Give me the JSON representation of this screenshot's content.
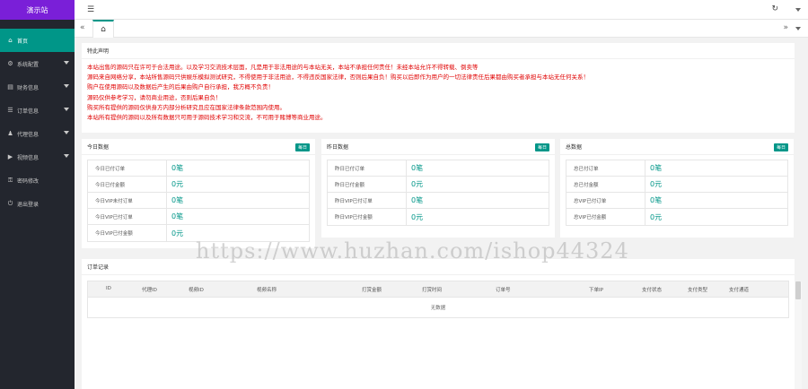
{
  "sidebar": {
    "logo": "演示站",
    "items": [
      {
        "icon": "home-icon",
        "glyph": "⌂",
        "label": "首页",
        "active": true,
        "has_arrow": false
      },
      {
        "icon": "settings-icon",
        "glyph": "⚙",
        "label": "系统配置",
        "active": false,
        "has_arrow": true
      },
      {
        "icon": "finance-icon",
        "glyph": "▤",
        "label": "财务信息",
        "active": false,
        "has_arrow": true
      },
      {
        "icon": "order-icon",
        "glyph": "☰",
        "label": "订单信息",
        "active": false,
        "has_arrow": true
      },
      {
        "icon": "agent-icon",
        "glyph": "♟",
        "label": "代理信息",
        "active": false,
        "has_arrow": true
      },
      {
        "icon": "video-icon",
        "glyph": "▶",
        "label": "视频信息",
        "active": false,
        "has_arrow": true
      },
      {
        "icon": "password-icon",
        "glyph": "⚿",
        "label": "密码修改",
        "active": false,
        "has_arrow": false
      },
      {
        "icon": "logout-icon",
        "glyph": "⏻",
        "label": "退出登录",
        "active": false,
        "has_arrow": false
      }
    ]
  },
  "header": {
    "menu_icon": "☰",
    "refresh_icon": "↻"
  },
  "tabs": {
    "prev_icon": "«",
    "home_icon": "⌂",
    "next_icon": "»"
  },
  "notice": {
    "title": "特此声明",
    "lines": [
      "本站出售的源码只在许可于合法用途。以及学习交流技术层面，凡是用于非法用途的与本站无关，本站不承担任何责任！未经本站允许不得转载、倒卖等",
      "源码来自网络分享，本站所售源码只供娱乐模拟测试研究，不得使用于非法用途，不得违反国家法律，否则后果自负！购买以后即作为用户的一切法律责任后果都由购买者承担与本站无任何关系！",
      "购户在使用源码以及数据后产生的后果由购户自行承担，我方概不负责！",
      "源码仅供参考学习，请勿商业用途，否则后果自负！",
      "购买所有提供的源码仅供身方内部分析研究且应在国家法律条款范围内使用。",
      "本站所有提供的源码以及所有数据只可用于源码技术学习和交流，不可用于赌博等商业用途。"
    ]
  },
  "today": {
    "title": "今日数据",
    "badge": "每日",
    "rows": [
      {
        "label": "今日已付订单",
        "value": "0笔"
      },
      {
        "label": "今日已付金额",
        "value": "0元"
      },
      {
        "label": "今日VIP未付订单",
        "value": "0笔"
      },
      {
        "label": "今日VIP已付订单",
        "value": "0笔"
      },
      {
        "label": "今日VIP已付金额",
        "value": "0元"
      }
    ]
  },
  "yesterday": {
    "title": "昨日数据",
    "badge": "每日",
    "rows": [
      {
        "label": "昨日已付订单",
        "value": "0笔"
      },
      {
        "label": "昨日已付金额",
        "value": "0元"
      },
      {
        "label": "昨日VIP已付订单",
        "value": "0笔"
      },
      {
        "label": "昨日VIP已付金额",
        "value": "0元"
      }
    ]
  },
  "total": {
    "title": "总数据",
    "badge": "每日",
    "rows": [
      {
        "label": "总已付订单",
        "value": "0笔"
      },
      {
        "label": "总已付金额",
        "value": "0元"
      },
      {
        "label": "总VIP已付订单",
        "value": "0笔"
      },
      {
        "label": "总VIP已付金额",
        "value": "0元"
      }
    ]
  },
  "orders": {
    "title": "订单记录",
    "columns": [
      "ID",
      "代理ID",
      "视频ID",
      "视频名称",
      "打赏金额",
      "打赏时间",
      "订单号",
      "下单IP",
      "支付状态",
      "支付类型",
      "支付通道"
    ],
    "empty_text": "无数据"
  },
  "watermark": "https://www.huzhan.com/ishop44324"
}
